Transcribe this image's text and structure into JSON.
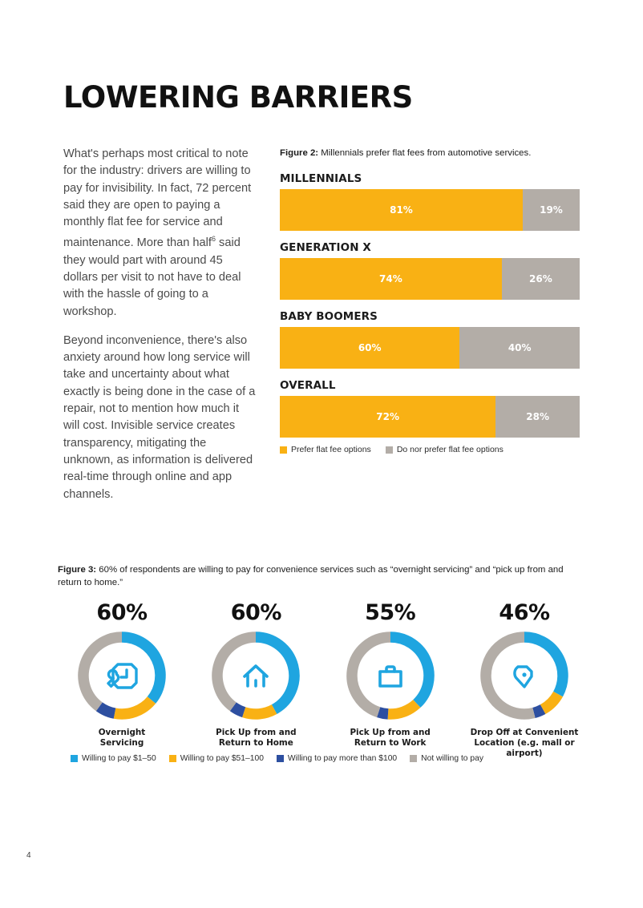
{
  "page": {
    "title": "LOWERING BARRIERS",
    "page_number": "4"
  },
  "body": {
    "paragraphs": [
      "What's perhaps most critical to note for the industry: drivers are willing to pay for invisibility. In fact, 72 percent said they are open to paying a monthly flat fee for service and maintenance. More than half",
      "Beyond inconvenience, there's also anxiety around how long service will take and uncertainty about what exactly is being done in the case of a repair, not to mention how much it will cost. Invisible service creates transparency, mitigating the unknown, as information is delivered real-time through online and app channels."
    ],
    "footnote_marker": "6",
    "paragraph1_tail": " said they would part with around 45 dollars per visit to not have to deal with the hassle of going to a workshop."
  },
  "figure2": {
    "caption_label": "Figure 2:",
    "caption_text": " Millennials prefer flat fees from automotive services.",
    "legend": [
      {
        "label": "Prefer flat fee options",
        "color": "#F9B114"
      },
      {
        "label": "Do nor prefer flat fee options",
        "color": "#B3ADA7"
      }
    ]
  },
  "figure3": {
    "caption_label": "Figure 3:",
    "caption_text": " 60% of respondents are willing to pay for convenience services such as “overnight servicing” and “pick up from and return to home.”",
    "legend": [
      {
        "label": "Willing to pay $1–50",
        "color": "#1FA5E0"
      },
      {
        "label": "Willing to pay $51–100",
        "color": "#F9B114"
      },
      {
        "label": "Willing to pay more than $100",
        "color": "#2D4FA0"
      },
      {
        "label": "Not willing to pay",
        "color": "#B3ADA7"
      }
    ]
  },
  "chart_data": [
    {
      "type": "bar",
      "orientation": "horizontal-stacked",
      "title": "Millennials prefer flat fees from automotive services.",
      "figure": "Figure 2",
      "xlabel": "",
      "ylabel": "",
      "xlim": [
        0,
        100
      ],
      "grid": false,
      "legend_position": "bottom-left",
      "categories": [
        "MILLENNIALS",
        "GENERATION X",
        "BABY BOOMERS",
        "OVERALL"
      ],
      "series": [
        {
          "name": "Prefer flat fee options",
          "color": "#F9B114",
          "values": [
            81,
            74,
            60,
            72
          ],
          "labels": [
            "81%",
            "74%",
            "60%",
            "72%"
          ]
        },
        {
          "name": "Do nor prefer flat fee options",
          "color": "#B3ADA7",
          "values": [
            19,
            26,
            40,
            28
          ],
          "labels": [
            "19%",
            "26%",
            "40%",
            "28%"
          ]
        }
      ]
    },
    {
      "type": "pie",
      "variant": "donut-group",
      "figure": "Figure 3",
      "title": "60% of respondents are willing to pay for convenience services such as “overnight servicing” and “pick up from and return to home.”",
      "legend_position": "bottom",
      "legend_entries": [
        "Willing to pay $1–50",
        "Willing to pay $51–100",
        "Willing to pay more than $100",
        "Not willing to pay"
      ],
      "slice_colors": [
        "#1FA5E0",
        "#F9B114",
        "#2D4FA0",
        "#B3ADA7"
      ],
      "donuts": [
        {
          "headline": "60%",
          "caption": "Overnight\nServicing",
          "icon": "wrench-clock-icon",
          "values": [
            36,
            17,
            7,
            40
          ],
          "slice_labels": [
            "Willing to pay $1–50",
            "Willing to pay $51–100",
            "Willing to pay more than $100",
            "Not willing to pay"
          ]
        },
        {
          "headline": "60%",
          "caption": "Pick Up from and\nReturn to Home",
          "icon": "house-icon",
          "values": [
            42,
            13,
            5,
            40
          ],
          "slice_labels": [
            "Willing to pay $1–50",
            "Willing to pay $51–100",
            "Willing to pay more than $100",
            "Not willing to pay"
          ]
        },
        {
          "headline": "55%",
          "caption": "Pick Up from and\nReturn to Work",
          "icon": "briefcase-icon",
          "values": [
            38,
            13,
            4,
            45
          ],
          "slice_labels": [
            "Willing to pay $1–50",
            "Willing to pay $51–100",
            "Willing to pay more than $100",
            "Not willing to pay"
          ]
        },
        {
          "headline": "46%",
          "caption": "Drop Off at Convenient\nLocation (e.g. mall or airport)",
          "icon": "location-pin-icon",
          "values": [
            33,
            9,
            4,
            54
          ],
          "slice_labels": [
            "Willing to pay $1–50",
            "Willing to pay $51–100",
            "Willing to pay more than $100",
            "Not willing to pay"
          ]
        }
      ]
    }
  ]
}
